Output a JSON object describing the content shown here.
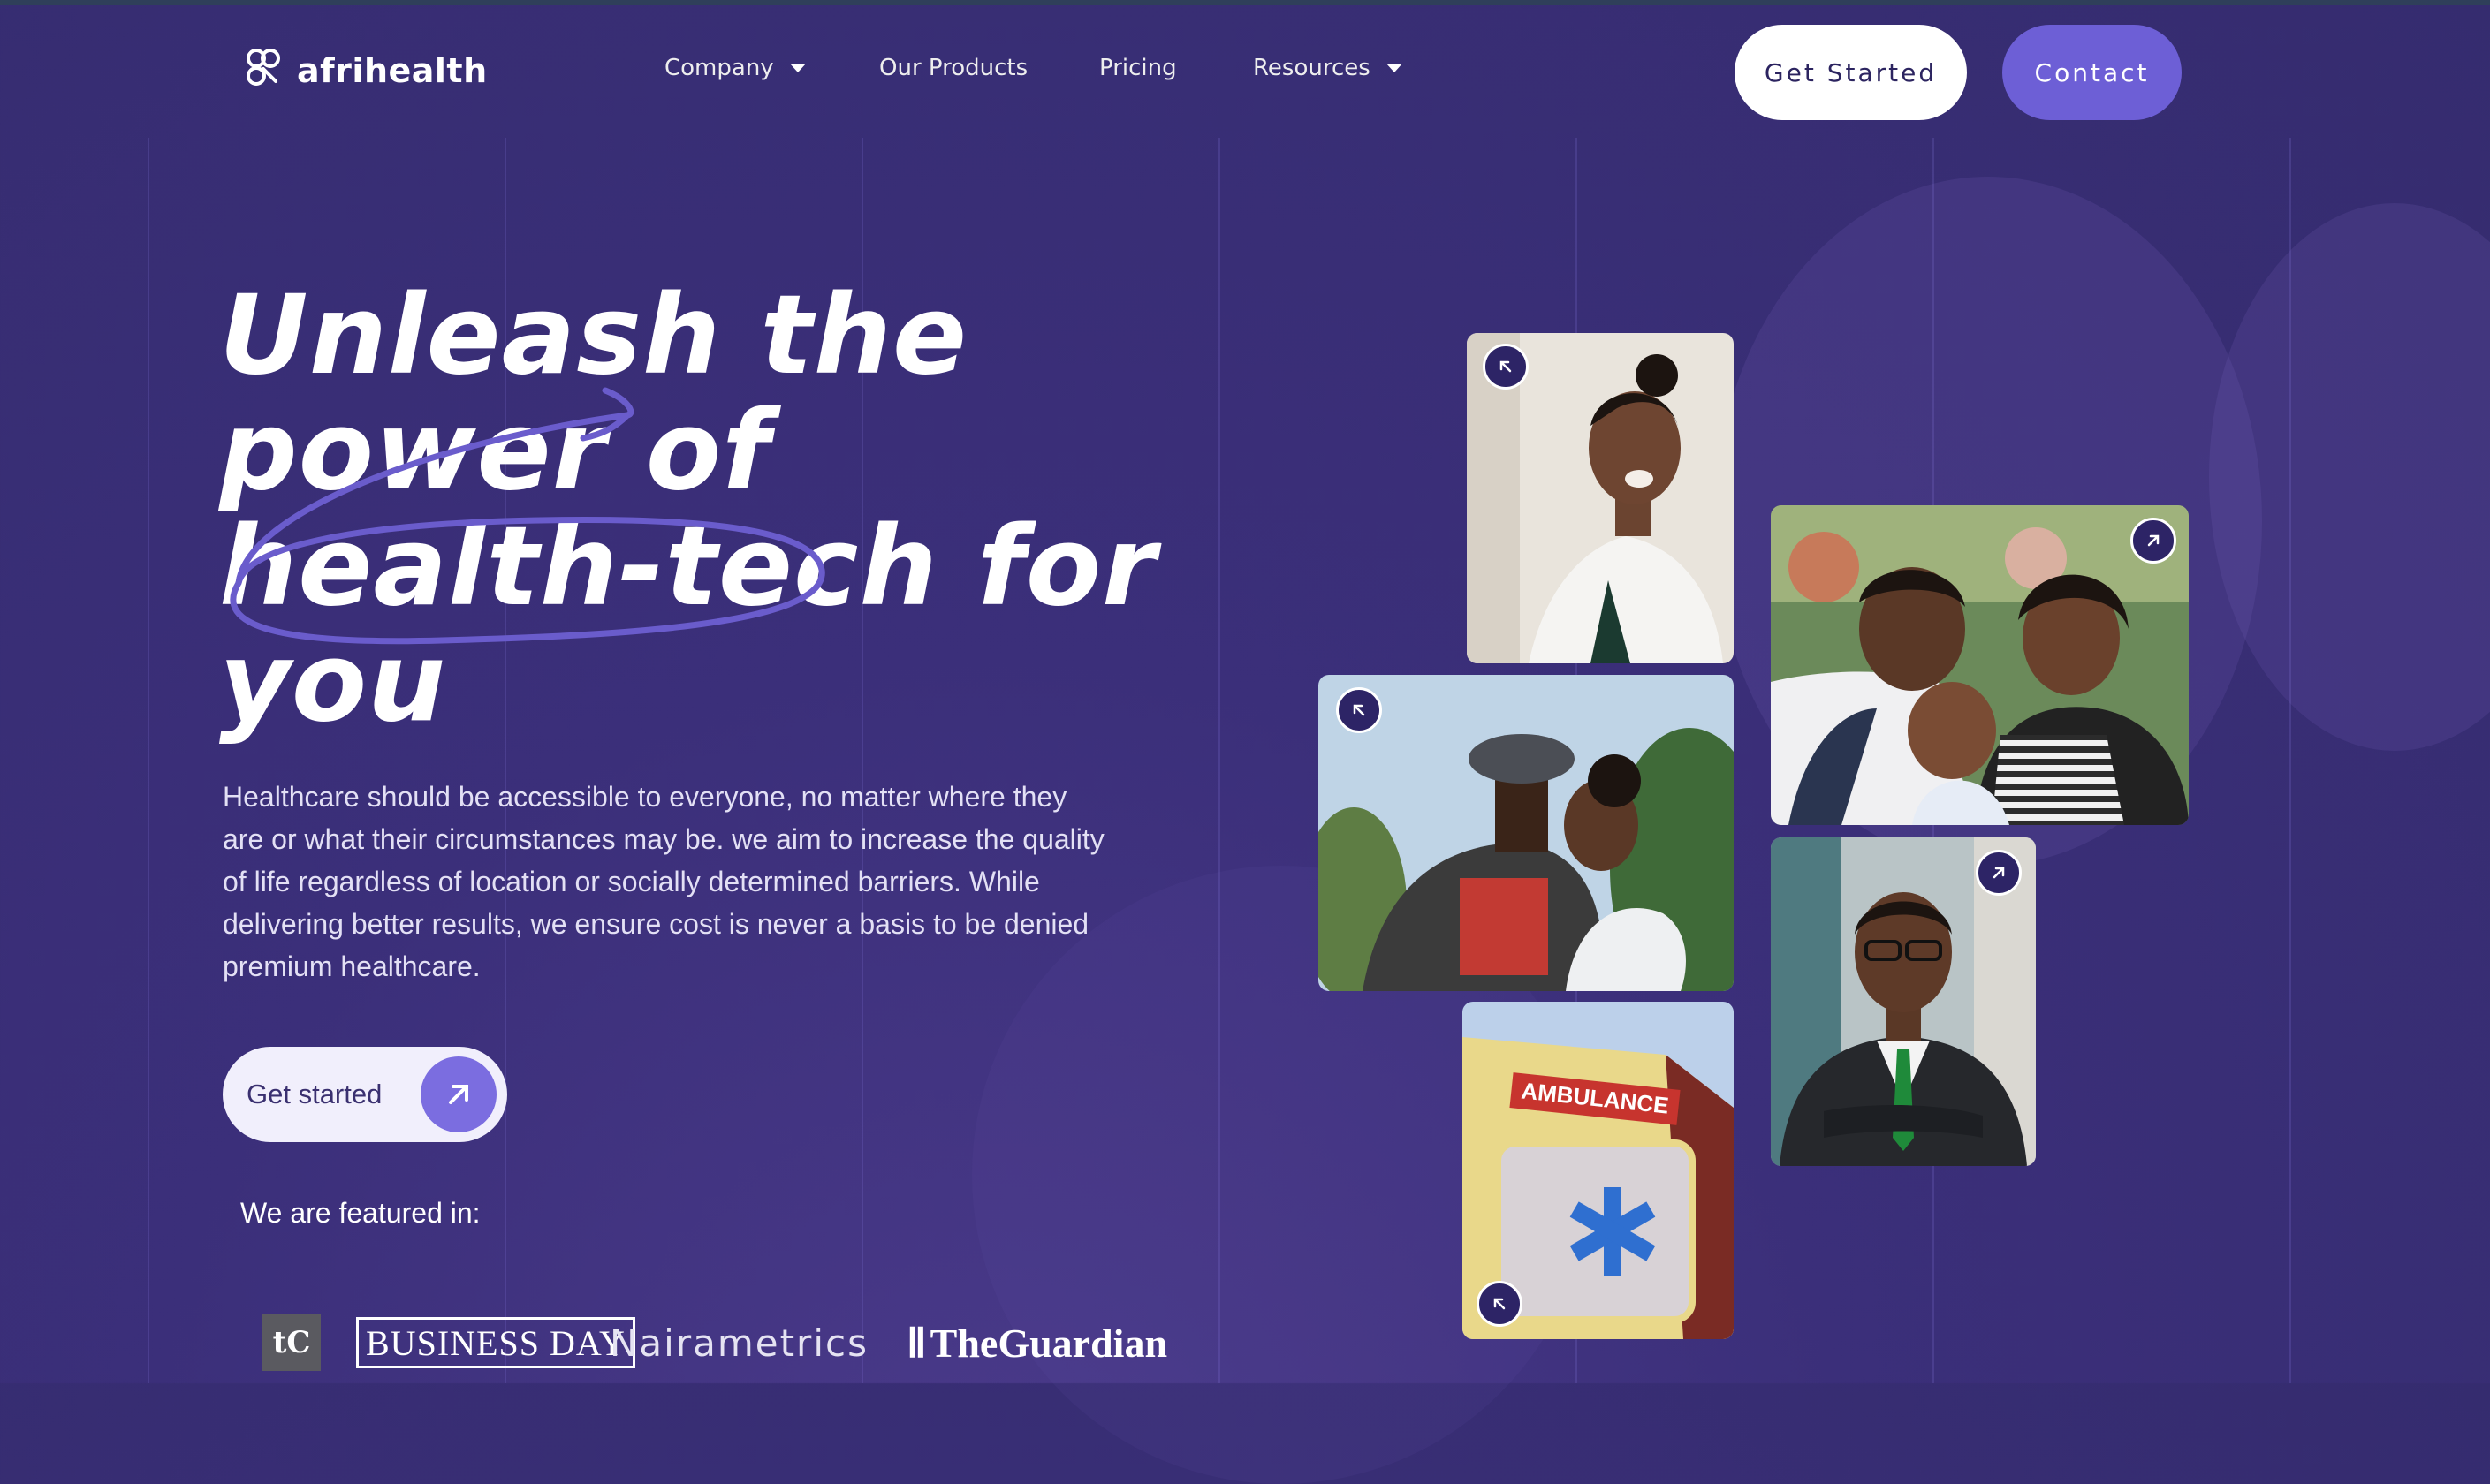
{
  "brand": {
    "name": "afrihealth"
  },
  "nav": {
    "company": "Company",
    "products": "Our Products",
    "pricing": "Pricing",
    "resources": "Resources"
  },
  "header": {
    "get_started": "Get Started",
    "contact": "Contact"
  },
  "hero": {
    "line1": "Unleash the",
    "line2": "power of",
    "line3": "health-tech for",
    "line4": "you",
    "description": "Healthcare should be accessible to everyone, no matter where they are or what their circumstances may be. we aim to increase the quality of life regardless of location or socially determined barriers. While delivering better results, we ensure cost is never a basis to be denied premium healthcare.",
    "cta": "Get started"
  },
  "featured": {
    "label": "We are featured in:",
    "logos": [
      "tC",
      "BUSINESS DAY",
      "Nairametrics",
      "TheGuardian"
    ]
  },
  "ambulance_text": "AMBULANCE",
  "colors": {
    "background": "#3b2f7a",
    "accent": "#6d5fd6",
    "button_light": "#ffffff",
    "badge": "#2d2466"
  }
}
